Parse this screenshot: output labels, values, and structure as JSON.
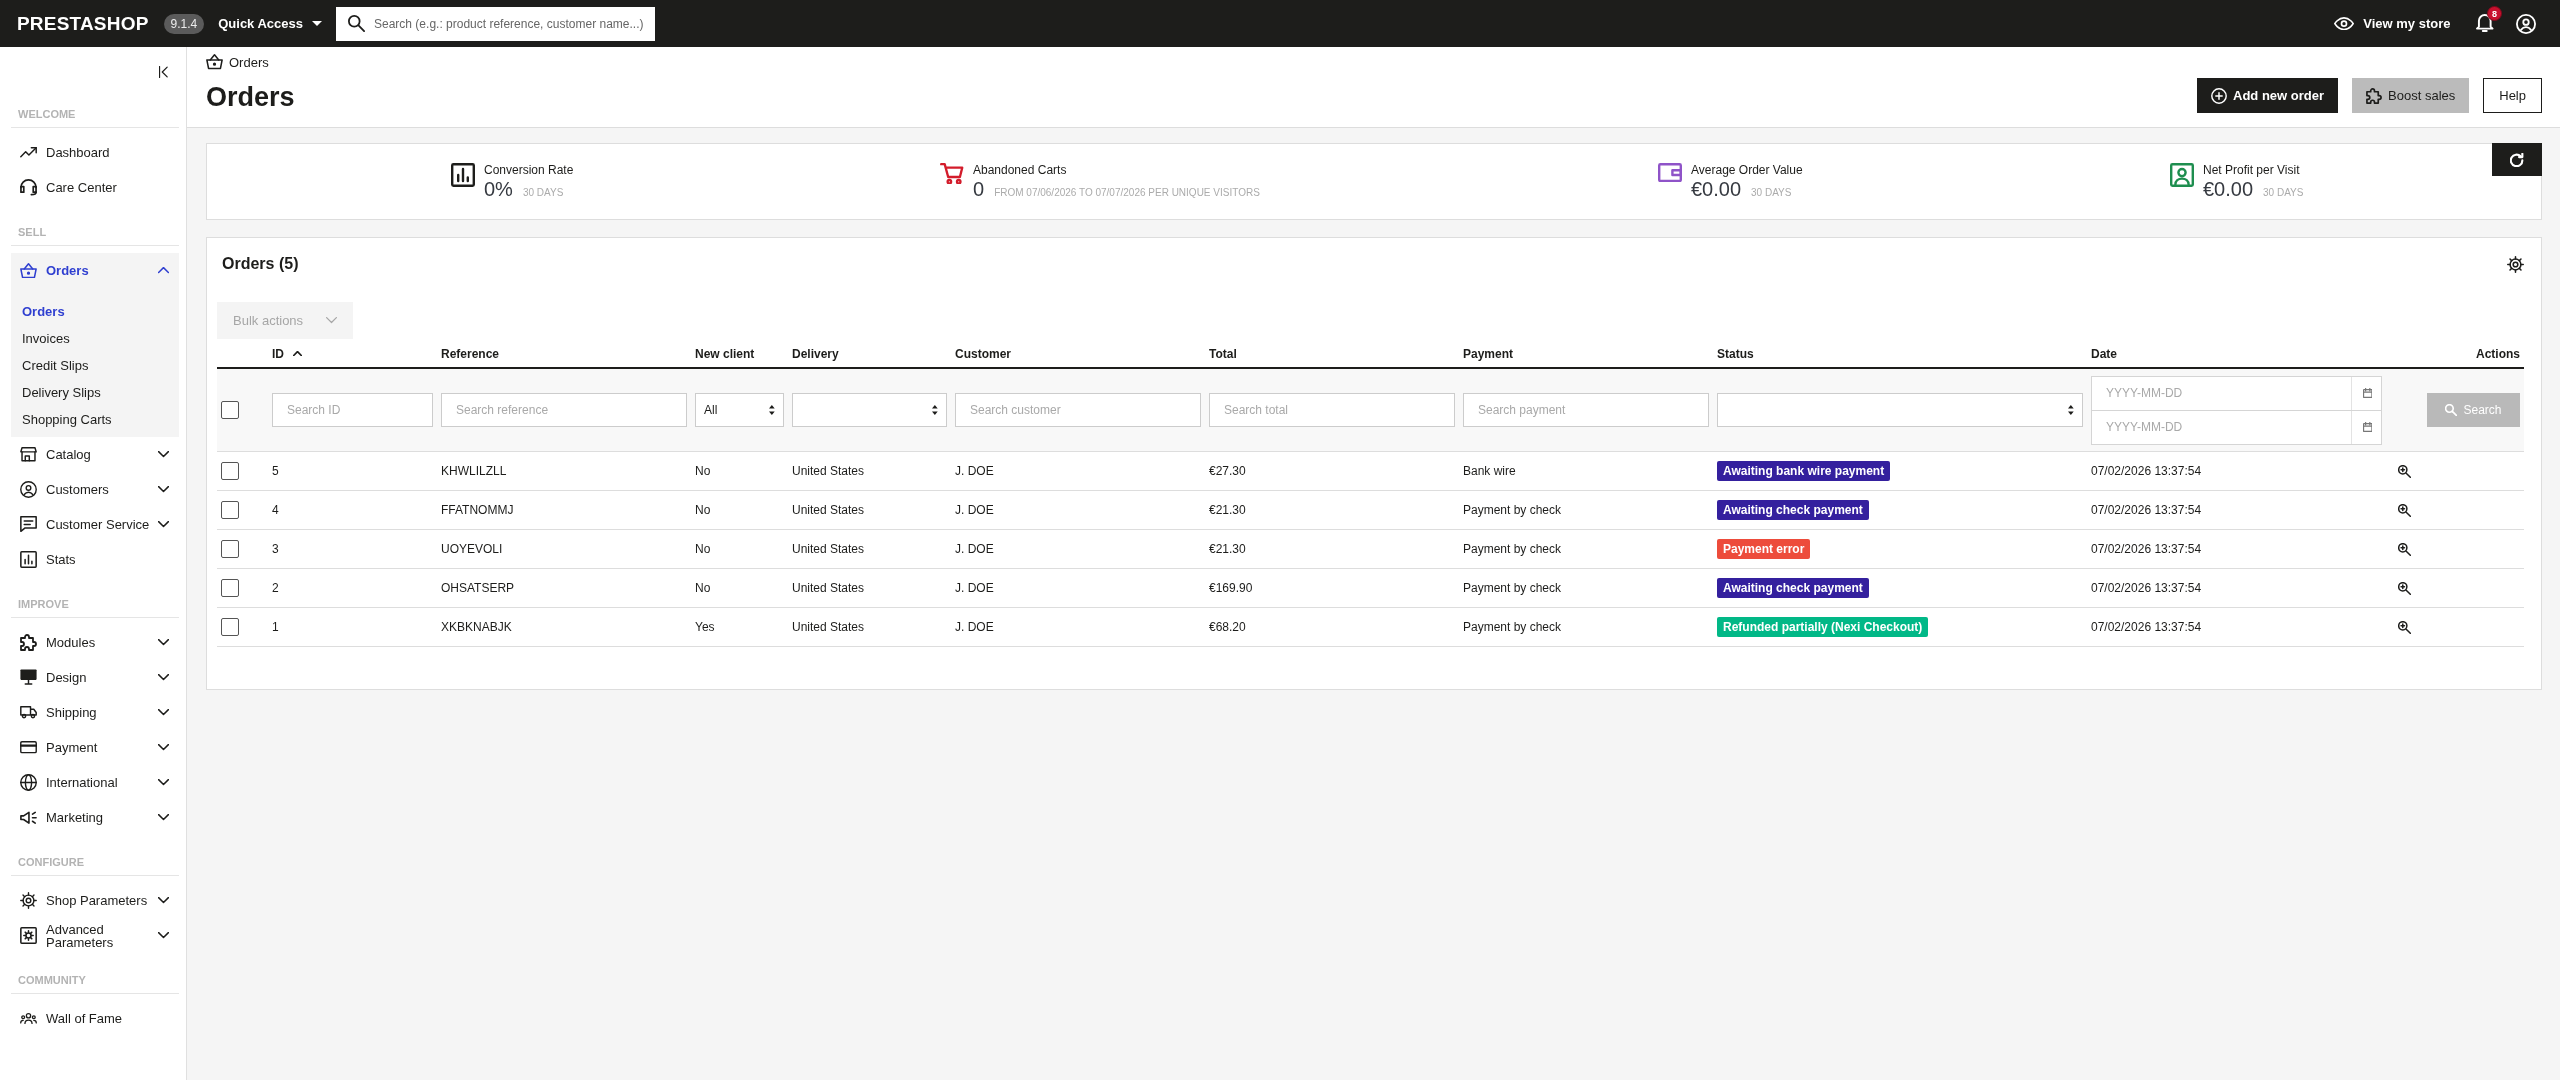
{
  "topbar": {
    "logo": "PRESTASHOP",
    "version": "9.1.4",
    "quick_access": "Quick Access",
    "search": {
      "placeholder": "Search (e.g.: product reference, customer name...)"
    },
    "view_store": "View my store",
    "notifications": "8"
  },
  "sidebar": {
    "sections": [
      {
        "title": "WELCOME",
        "items": [
          {
            "kind": "link",
            "label": "Dashboard",
            "selected": false
          },
          {
            "kind": "link",
            "label": "Care Center",
            "selected": false
          }
        ]
      },
      {
        "title": "SELL",
        "items": [
          {
            "kind": "group",
            "label": "Orders",
            "selected": true,
            "expanded": true,
            "children": [
              {
                "label": "Orders",
                "selected": true
              },
              {
                "label": "Invoices",
                "selected": false
              },
              {
                "label": "Credit Slips",
                "selected": false
              },
              {
                "label": "Delivery Slips",
                "selected": false
              },
              {
                "label": "Shopping Carts",
                "selected": false
              }
            ]
          },
          {
            "kind": "group",
            "label": "Catalog",
            "selected": false,
            "expanded": false
          },
          {
            "kind": "group",
            "label": "Customers",
            "selected": false,
            "expanded": false
          },
          {
            "kind": "group",
            "label": "Customer Service",
            "selected": false,
            "expanded": false
          },
          {
            "kind": "link",
            "label": "Stats",
            "selected": false
          }
        ]
      },
      {
        "title": "IMPROVE",
        "items": [
          {
            "kind": "group",
            "label": "Modules",
            "selected": false,
            "expanded": false
          },
          {
            "kind": "group",
            "label": "Design",
            "selected": false,
            "expanded": false
          },
          {
            "kind": "group",
            "label": "Shipping",
            "selected": false,
            "expanded": false
          },
          {
            "kind": "group",
            "label": "Payment",
            "selected": false,
            "expanded": false
          },
          {
            "kind": "group",
            "label": "International",
            "selected": false,
            "expanded": false
          },
          {
            "kind": "group",
            "label": "Marketing",
            "selected": false,
            "expanded": false
          }
        ]
      },
      {
        "title": "CONFIGURE",
        "items": [
          {
            "kind": "group",
            "label": "Shop Parameters",
            "selected": false,
            "expanded": false
          },
          {
            "kind": "group",
            "label": "Advanced Parameters",
            "selected": false,
            "expanded": false
          }
        ]
      },
      {
        "title": "COMMUNITY",
        "items": [
          {
            "kind": "link",
            "label": "Wall of Fame",
            "selected": false
          }
        ]
      }
    ]
  },
  "breadcrumb": "Orders",
  "page_title": "Orders",
  "header_buttons": [
    {
      "kind": "primary",
      "label": "Add new order"
    },
    {
      "kind": "secondary",
      "label": "Boost sales"
    },
    {
      "kind": "outline",
      "label": "Help"
    }
  ],
  "kpis": [
    {
      "label": "Conversion Rate",
      "value": "0%",
      "note": "30 DAYS",
      "color": "#1d1d1b"
    },
    {
      "label": "Abandoned Carts",
      "value": "0",
      "note": "FROM 07/06/2026 TO 07/07/2026 PER UNIQUE VISITORS",
      "color": "#d31c2b"
    },
    {
      "label": "Average Order Value",
      "value": "€0.00",
      "note": "30 DAYS",
      "color": "#8f53c8"
    },
    {
      "label": "Net Profit per Visit",
      "value": "€0.00",
      "note": "30 DAYS",
      "color": "#1e8e4f"
    }
  ],
  "orders": {
    "title": "Orders (5)",
    "bulk_actions": {
      "label": "Bulk actions",
      "disabled": true
    },
    "columns": [
      {
        "label": "ID",
        "sorted": true
      },
      {
        "label": "Reference",
        "sorted": false
      },
      {
        "label": "New client",
        "sorted": false
      },
      {
        "label": "Delivery",
        "sorted": false
      },
      {
        "label": "Customer",
        "sorted": false
      },
      {
        "label": "Total",
        "sorted": false
      },
      {
        "label": "Payment",
        "sorted": false
      },
      {
        "label": "Status",
        "sorted": false
      },
      {
        "label": "Date",
        "sorted": false
      },
      {
        "label": "Actions",
        "sorted": false
      }
    ],
    "filters": [
      {
        "kind": "checkbox",
        "checked": false
      },
      {
        "kind": "text",
        "placeholder": "Search ID"
      },
      {
        "kind": "text",
        "placeholder": "Search reference"
      },
      {
        "kind": "select",
        "value": "All"
      },
      {
        "kind": "select"
      },
      {
        "kind": "text",
        "placeholder": "Search customer"
      },
      {
        "kind": "text",
        "placeholder": "Search total"
      },
      {
        "kind": "text",
        "placeholder": "Search payment"
      },
      {
        "kind": "select"
      },
      {
        "kind": "daterange",
        "from": {
          "placeholder": "YYYY-MM-DD"
        },
        "to": {
          "placeholder": "YYYY-MM-DD"
        }
      },
      {
        "kind": "button",
        "label": "Search",
        "disabled": true
      }
    ],
    "rows": [
      {
        "checked": false,
        "id": "5",
        "reference": "KHWLILZLL",
        "new_client": "No",
        "delivery": "United States",
        "customer": "J. DOE",
        "total": "€27.30",
        "payment": "Bank wire",
        "status": {
          "label": "Awaiting bank wire payment",
          "color": "#34209e"
        },
        "date": "07/02/2026 13:37:54"
      },
      {
        "checked": false,
        "id": "4",
        "reference": "FFATNOMMJ",
        "new_client": "No",
        "delivery": "United States",
        "customer": "J. DOE",
        "total": "€21.30",
        "payment": "Payment by check",
        "status": {
          "label": "Awaiting check payment",
          "color": "#34209e"
        },
        "date": "07/02/2026 13:37:54"
      },
      {
        "checked": false,
        "id": "3",
        "reference": "UOYEVOLI",
        "new_client": "No",
        "delivery": "United States",
        "customer": "J. DOE",
        "total": "€21.30",
        "payment": "Payment by check",
        "status": {
          "label": "Payment error",
          "color": "#ed4c3b"
        },
        "date": "07/02/2026 13:37:54"
      },
      {
        "checked": false,
        "id": "2",
        "reference": "OHSATSERP",
        "new_client": "No",
        "delivery": "United States",
        "customer": "J. DOE",
        "total": "€169.90",
        "payment": "Payment by check",
        "status": {
          "label": "Awaiting check payment",
          "color": "#34209e"
        },
        "date": "07/02/2026 13:37:54"
      },
      {
        "checked": false,
        "id": "1",
        "reference": "XKBKNABJK",
        "new_client": "Yes",
        "delivery": "United States",
        "customer": "J. DOE",
        "total": "€68.20",
        "payment": "Payment by check",
        "status": {
          "label": "Refunded partially (Nexi Checkout)",
          "color": "#01b887"
        },
        "date": "07/02/2026 13:37:54"
      }
    ]
  }
}
